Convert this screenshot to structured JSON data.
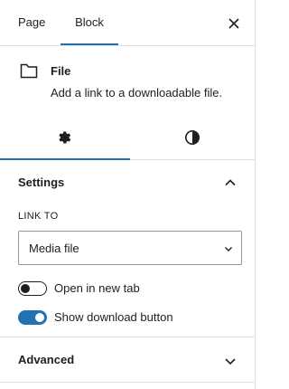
{
  "header": {
    "tabs": [
      {
        "label": "Page",
        "active": false
      },
      {
        "label": "Block",
        "active": true
      }
    ],
    "close_icon": "close-icon"
  },
  "block": {
    "icon": "folder-icon",
    "title": "File",
    "description": "Add a link to a downloadable file."
  },
  "subtabs": [
    {
      "icon": "gear-icon",
      "active": true
    },
    {
      "icon": "contrast-icon",
      "active": false
    }
  ],
  "settings": {
    "title": "Settings",
    "expanded": true,
    "link_to": {
      "label": "LINK TO",
      "value": "Media file"
    },
    "toggles": [
      {
        "label": "Open in new tab",
        "on": false
      },
      {
        "label": "Show download button",
        "on": true
      }
    ]
  },
  "advanced": {
    "title": "Advanced",
    "expanded": false
  },
  "colors": {
    "accent": "#2271b1",
    "text": "#1e1e1e",
    "border": "#e0e0e0"
  }
}
